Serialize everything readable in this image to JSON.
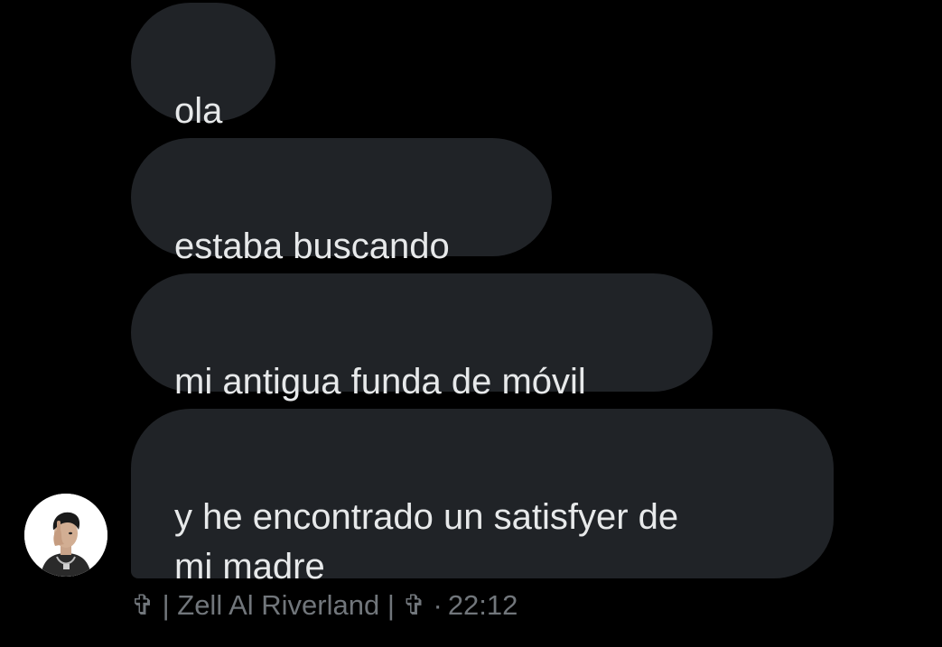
{
  "conversation": {
    "messages": [
      {
        "text": "ola"
      },
      {
        "text": "estaba buscando"
      },
      {
        "text": "mi antigua funda de móvil"
      },
      {
        "text": "y he encontrado un satisfyer de\nmi madre"
      }
    ],
    "sender_line": "✞ | Zell Al Riverland | ✞",
    "timestamp": "22:12",
    "separator": "·"
  },
  "colors": {
    "background": "#000000",
    "bubble": "#202327",
    "text": "#e7e9ea",
    "meta_text": "#71767b",
    "avatar_bg": "#ffffff"
  },
  "icons": {
    "avatar": "user-avatar-photo"
  }
}
